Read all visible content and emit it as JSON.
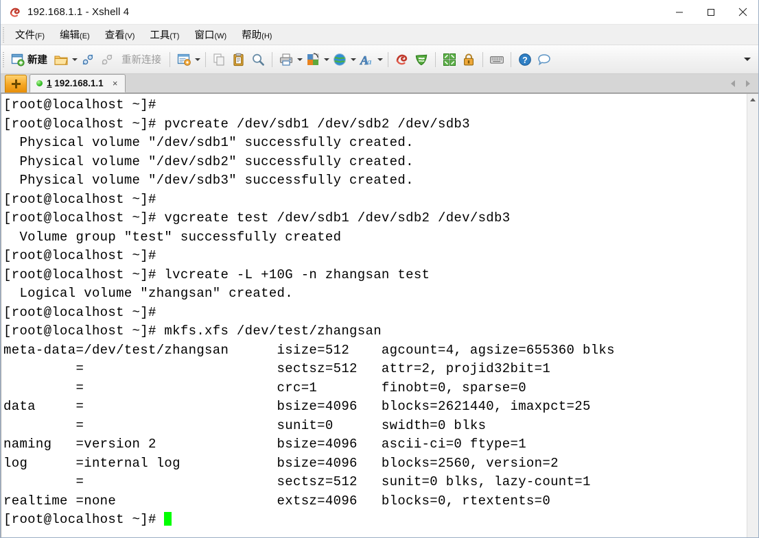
{
  "window": {
    "title": "192.168.1.1 - Xshell 4",
    "app_icon": "xshell-icon",
    "controls": {
      "minimize": "minimize-icon",
      "maximize": "maximize-icon",
      "close": "close-icon"
    }
  },
  "menubar": {
    "items": [
      {
        "label": "文件",
        "mnemonic": "(F)"
      },
      {
        "label": "编辑",
        "mnemonic": "(E)"
      },
      {
        "label": "查看",
        "mnemonic": "(V)"
      },
      {
        "label": "工具",
        "mnemonic": "(T)"
      },
      {
        "label": "窗口",
        "mnemonic": "(W)"
      },
      {
        "label": "帮助",
        "mnemonic": "(H)"
      }
    ]
  },
  "toolbar": {
    "new_label": "新建",
    "reconnect_label": "重新连接",
    "items": [
      {
        "name": "new-session-button",
        "icon": "new-window-icon",
        "label": "新建"
      },
      {
        "name": "open-folder-button",
        "icon": "folder-open-icon",
        "dropdown": true
      },
      {
        "name": "connect-button",
        "icon": "connect-plug-icon"
      },
      {
        "name": "disconnect-button",
        "icon": "disconnect-plug-icon",
        "disabled": true
      },
      {
        "name": "reconnect-button",
        "icon": "reconnect-label",
        "label": "重新连接",
        "disabled": true
      },
      {
        "name": "session-properties-button",
        "icon": "properties-icon",
        "dropdown": true
      },
      {
        "name": "copy-button",
        "icon": "copy-icon",
        "disabled": true
      },
      {
        "name": "paste-button",
        "icon": "paste-clipboard-icon"
      },
      {
        "name": "find-button",
        "icon": "search-magnifier-icon"
      },
      {
        "name": "print-button",
        "icon": "printer-icon",
        "dropdown": true
      },
      {
        "name": "arrange-layout-button",
        "icon": "layout-color-icon",
        "dropdown": true
      },
      {
        "name": "web-transfer-button",
        "icon": "globe-icon",
        "dropdown": true
      },
      {
        "name": "font-button",
        "icon": "font-a-icon",
        "dropdown": true
      },
      {
        "name": "xshell-button",
        "icon": "xshell-red-icon"
      },
      {
        "name": "xftp-button",
        "icon": "xftp-green-icon"
      },
      {
        "name": "tile-windows-button",
        "icon": "tile-arrows-icon"
      },
      {
        "name": "lock-button",
        "icon": "padlock-icon"
      },
      {
        "name": "keyboard-button",
        "icon": "keyboard-icon"
      },
      {
        "name": "help-button",
        "icon": "help-question-icon"
      },
      {
        "name": "feedback-button",
        "icon": "speech-bubble-icon"
      }
    ],
    "overflow": "toolbar-overflow-icon"
  },
  "tabbar": {
    "new_tab": "new-tab-plus-icon",
    "tabs": [
      {
        "index": "1",
        "title": "192.168.1.1",
        "status": "connected",
        "close": "×",
        "active": true
      }
    ],
    "nav_prev": "tab-scroll-left-icon",
    "nav_next": "tab-scroll-right-icon"
  },
  "terminal": {
    "prompt": "[root@localhost ~]#",
    "cursor_color": "#00ff00",
    "foreground": "#000000",
    "background": "#ffffff",
    "lines": [
      "[root@localhost ~]#",
      "[root@localhost ~]# pvcreate /dev/sdb1 /dev/sdb2 /dev/sdb3",
      "  Physical volume \"/dev/sdb1\" successfully created.",
      "  Physical volume \"/dev/sdb2\" successfully created.",
      "  Physical volume \"/dev/sdb3\" successfully created.",
      "[root@localhost ~]#",
      "[root@localhost ~]# vgcreate test /dev/sdb1 /dev/sdb2 /dev/sdb3",
      "  Volume group \"test\" successfully created",
      "[root@localhost ~]#",
      "[root@localhost ~]# lvcreate -L +10G -n zhangsan test",
      "  Logical volume \"zhangsan\" created.",
      "[root@localhost ~]#",
      "[root@localhost ~]# mkfs.xfs /dev/test/zhangsan",
      "meta-data=/dev/test/zhangsan      isize=512    agcount=4, agsize=655360 blks",
      "         =                        sectsz=512   attr=2, projid32bit=1",
      "         =                        crc=1        finobt=0, sparse=0",
      "data     =                        bsize=4096   blocks=2621440, imaxpct=25",
      "         =                        sunit=0      swidth=0 blks",
      "naming   =version 2               bsize=4096   ascii-ci=0 ftype=1",
      "log      =internal log            bsize=4096   blocks=2560, version=2",
      "         =                        sectsz=512   sunit=0 blks, lazy-count=1",
      "realtime =none                    extsz=4096   blocks=0, rtextents=0"
    ],
    "last_line": "[root@localhost ~]# ",
    "scrollbar": {
      "up": "scroll-up-icon",
      "down": "scroll-down-icon"
    }
  }
}
